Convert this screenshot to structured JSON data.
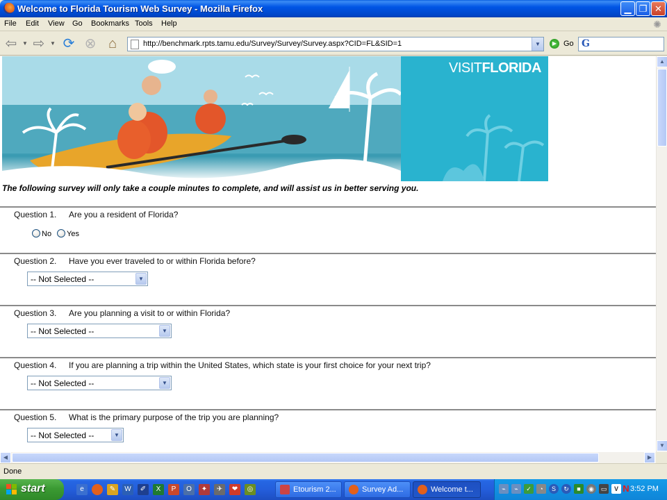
{
  "window": {
    "title": "Welcome to Florida Tourism Web Survey - Mozilla Firefox",
    "minimize": "▁",
    "maximize": "❐",
    "close": "✕"
  },
  "menu": {
    "items": [
      {
        "label": "File"
      },
      {
        "label": "Edit"
      },
      {
        "label": "View"
      },
      {
        "label": "Go"
      },
      {
        "label": "Bookmarks"
      },
      {
        "label": "Tools"
      },
      {
        "label": "Help"
      }
    ]
  },
  "toolbar": {
    "url": "http://benchmark.rpts.tamu.edu/Survey/Survey/Survey.aspx?CID=FL&SID=1",
    "go_label": "Go",
    "search_engine_glyph": "G"
  },
  "banner": {
    "logo_part1": "VISIT",
    "logo_part2": "FLORIDA",
    "colors": {
      "teal": "#29b3cf"
    }
  },
  "survey": {
    "intro": "The following survey will only take a couple minutes to complete, and will assist us in better serving you.",
    "questions": [
      {
        "label": "Question 1.",
        "text": "Are you a resident of Florida?",
        "type": "radio",
        "options": [
          "No",
          "Yes"
        ]
      },
      {
        "label": "Question 2.",
        "text": "Have you ever traveled to or within Florida before?",
        "type": "select",
        "value": "-- Not Selected --"
      },
      {
        "label": "Question 3.",
        "text": "Are you planning a visit to or within Florida?",
        "type": "select",
        "value": "-- Not Selected --"
      },
      {
        "label": "Question 4.",
        "text": "If you are planning a trip within the United States, which state is your first choice for your next trip?",
        "type": "select",
        "value": "-- Not Selected --"
      },
      {
        "label": "Question 5.",
        "text": "What is the primary purpose of the trip you are planning?",
        "type": "select",
        "value": "-- Not Selected --"
      }
    ]
  },
  "statusbar": {
    "status": "Done"
  },
  "taskbar": {
    "start_label": "start",
    "tasks": [
      {
        "label": "Etourism 2...",
        "active": false
      },
      {
        "label": "Survey Ad...",
        "active": false
      },
      {
        "label": "Welcome t...",
        "active": true
      }
    ],
    "clock": "3:52 PM"
  }
}
